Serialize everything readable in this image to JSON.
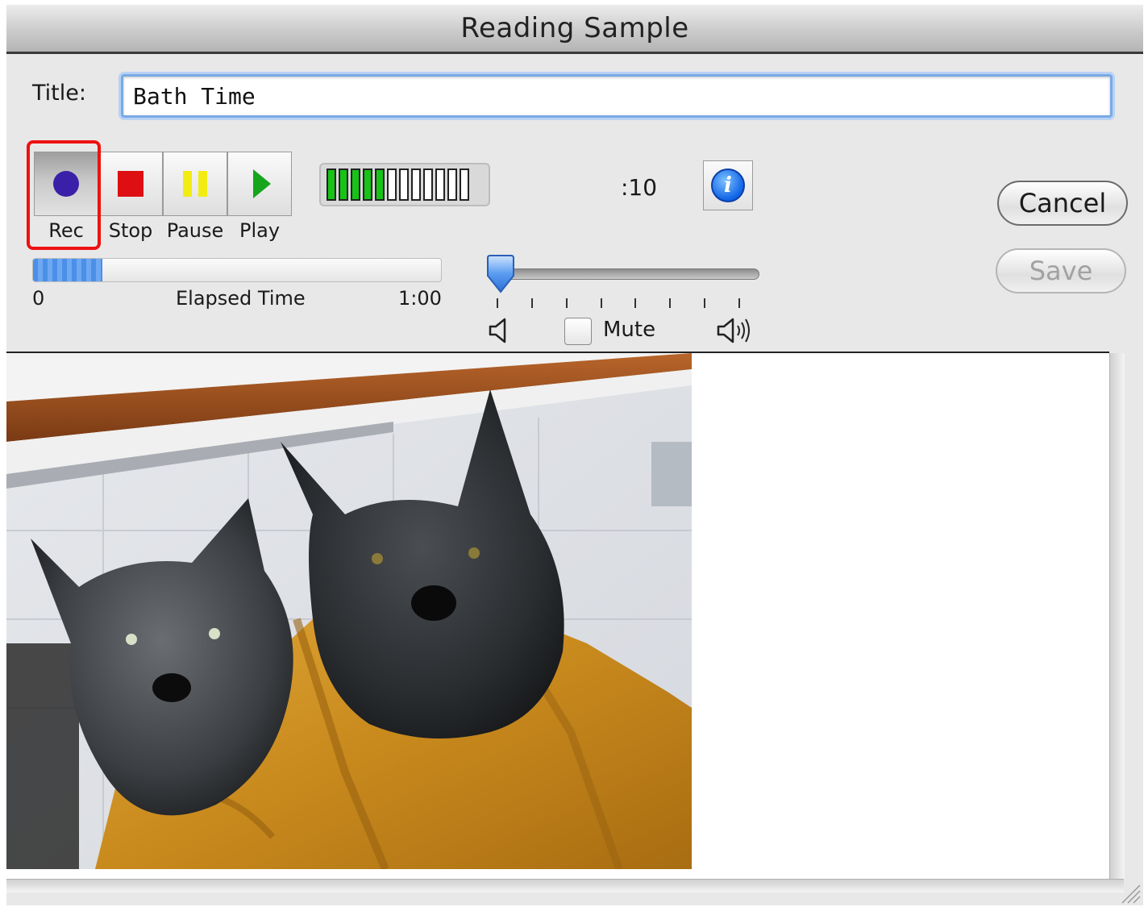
{
  "window": {
    "title": "Reading Sample"
  },
  "form": {
    "title_label": "Title:",
    "title_value": "Bath Time"
  },
  "transport": {
    "rec_label": "Rec",
    "stop_label": "Stop",
    "pause_label": "Pause",
    "play_label": "Play",
    "colors": {
      "rec": "#3a1fa8",
      "stop": "#dd0f12",
      "pause": "#f2ec12",
      "play": "#16a51c",
      "highlight": "#ee1111"
    }
  },
  "level_meter": {
    "segments_total": 12,
    "segments_lit": 5,
    "lit_color": "#16c416"
  },
  "time_readout": ":10",
  "progress": {
    "start_label": "0",
    "mid_label": "Elapsed Time",
    "end_label": "1:00",
    "fraction": 0.17
  },
  "volume": {
    "level": 0.0,
    "mute_label": "Mute",
    "mute_checked": false,
    "tick_count": 8
  },
  "buttons": {
    "cancel_label": "Cancel",
    "save_label": "Save",
    "save_enabled": false
  },
  "icons": {
    "info": "info-icon",
    "speaker_low": "speaker-low-icon",
    "speaker_high": "speaker-high-icon",
    "resize": "resize-grip-icon"
  }
}
